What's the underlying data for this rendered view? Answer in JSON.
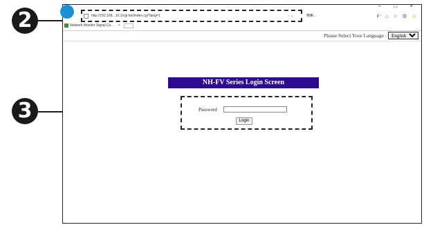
{
  "callouts": {
    "address_bar": "2",
    "login_area": "3"
  },
  "browser": {
    "address_url": "http://192.168...10.1/cgi-bin/index.cgi?lang=1",
    "address_nav": "- →",
    "search_placeholder": "検索...",
    "search_icon": "ρ -",
    "toolbar_icons": "⌂ ☆ ⚙",
    "smiley": "☺",
    "window_controls": "–  □  ×",
    "tab_title": "Network Monitor Signal Co...",
    "tab_close": "×"
  },
  "page": {
    "language_label": "Please Select Your Language :",
    "language_selected": "English",
    "title": "NH-FV Series Login Screen",
    "password_label": "Password",
    "password_value": "",
    "login_label": "Login"
  },
  "colors": {
    "banner": "#2e0a90",
    "callout": "#1a1a1a"
  }
}
